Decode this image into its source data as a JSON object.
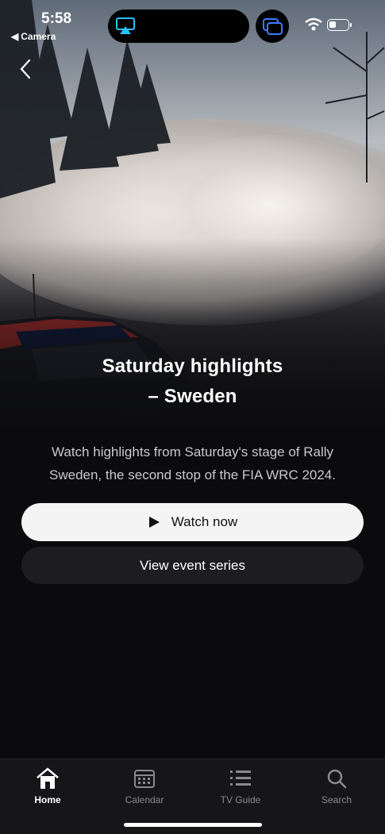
{
  "status_bar": {
    "time": "5:58",
    "back_app": "Camera"
  },
  "hero": {
    "image": "rally car in snow spray with trees"
  },
  "content": {
    "title_line1": "Saturday highlights",
    "title_line2": "– Sweden",
    "description": "Watch highlights from Saturday's stage of Rally Sweden, the second stop of the FIA WRC 2024."
  },
  "actions": {
    "watch_label": "Watch now",
    "series_label": "View event series"
  },
  "tabbar": {
    "items": [
      {
        "label": "Home",
        "icon": "home-icon",
        "active": true
      },
      {
        "label": "Calendar",
        "icon": "calendar-icon",
        "active": false
      },
      {
        "label": "TV Guide",
        "icon": "list-icon",
        "active": false
      },
      {
        "label": "Search",
        "icon": "search-icon",
        "active": false
      }
    ]
  },
  "colors": {
    "background": "#0b0b0d",
    "button_primary": "#f4f4f4",
    "button_secondary": "#1d1d21",
    "tab_inactive": "#8a8a8e"
  }
}
